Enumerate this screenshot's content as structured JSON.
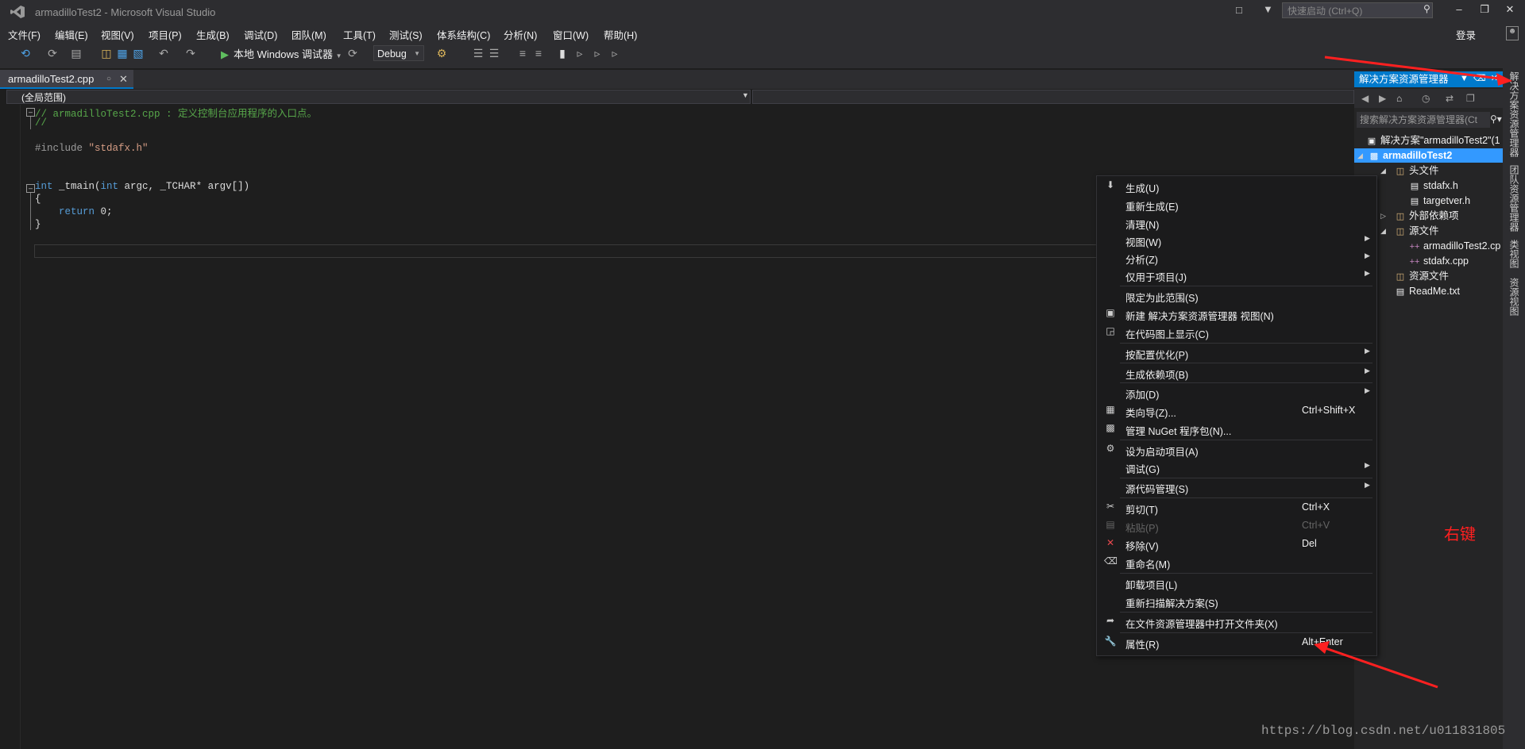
{
  "window": {
    "title": "armadilloTest2 - Microsoft Visual Studio",
    "quick_launch_placeholder": "快速启动 (Ctrl+Q)"
  },
  "menu": {
    "items": [
      "文件(F)",
      "编辑(E)",
      "视图(V)",
      "项目(P)",
      "生成(B)",
      "调试(D)",
      "团队(M)",
      "工具(T)",
      "测试(S)",
      "体系结构(C)",
      "分析(N)",
      "窗口(W)",
      "帮助(H)"
    ],
    "login": "登录"
  },
  "toolbar": {
    "run_label": "本地 Windows 调试器",
    "configuration": "Debug"
  },
  "editor": {
    "tab_title": "armadilloTest2.cpp",
    "scope": "(全局范围)",
    "code": {
      "line1": "// armadilloTest2.cpp : 定义控制台应用程序的入口点。",
      "line2": "//",
      "include_kw": "#include",
      "include_file": "\"stdafx.h\"",
      "main_kw": "int",
      "main_sig": " _tmain(",
      "main_kw2": "int",
      "main_rest": " argc, _TCHAR* argv[])",
      "brace_open": "{",
      "return_kw": "return",
      "return_rest": " 0;",
      "brace_close": "}"
    }
  },
  "solution_explorer": {
    "title": "解决方案资源管理器",
    "search_placeholder": "搜索解决方案资源管理器(Ct",
    "tree": {
      "solution": "解决方案\"armadilloTest2\"(1",
      "project": "armadilloTest2",
      "header_files": "头文件",
      "stdafx_h": "stdafx.h",
      "targetver_h": "targetver.h",
      "external_deps": "外部依赖项",
      "source_files": "源文件",
      "main_cpp": "armadilloTest2.cp",
      "stdafx_cpp": "stdafx.cpp",
      "resource_files": "资源文件",
      "readme": "ReadMe.txt"
    }
  },
  "side_tabs": [
    "解决方案资源管理器",
    "团队资源管理器",
    "类视图",
    "资源视图"
  ],
  "context_menu": {
    "items": [
      {
        "label": "生成(U)",
        "shortcut": "",
        "icon": "build-icon"
      },
      {
        "label": "重新生成(E)",
        "shortcut": ""
      },
      {
        "label": "清理(N)",
        "shortcut": ""
      },
      {
        "label": "视图(W)",
        "shortcut": "",
        "submenu": true
      },
      {
        "label": "分析(Z)",
        "shortcut": "",
        "submenu": true
      },
      {
        "label": "仅用于项目(J)",
        "shortcut": "",
        "submenu": true
      },
      {
        "label": "限定为此范围(S)",
        "shortcut": ""
      },
      {
        "label": "新建 解决方案资源管理器 视图(N)",
        "shortcut": "",
        "icon": "new-view-icon"
      },
      {
        "label": "在代码图上显示(C)",
        "shortcut": "",
        "icon": "code-map-icon"
      },
      {
        "label": "按配置优化(P)",
        "shortcut": "",
        "submenu": true
      },
      {
        "label": "生成依赖项(B)",
        "shortcut": "",
        "submenu": true
      },
      {
        "label": "添加(D)",
        "shortcut": "",
        "submenu": true
      },
      {
        "label": "类向导(Z)...",
        "shortcut": "Ctrl+Shift+X",
        "icon": "class-wizard-icon"
      },
      {
        "label": "管理 NuGet 程序包(N)...",
        "shortcut": "",
        "icon": "nuget-icon"
      },
      {
        "label": "设为启动项目(A)",
        "shortcut": "",
        "icon": "gear-icon"
      },
      {
        "label": "调试(G)",
        "shortcut": "",
        "submenu": true
      },
      {
        "label": "源代码管理(S)",
        "shortcut": "",
        "submenu": true
      },
      {
        "label": "剪切(T)",
        "shortcut": "Ctrl+X",
        "icon": "scissors-icon"
      },
      {
        "label": "粘贴(P)",
        "shortcut": "Ctrl+V",
        "icon": "paste-icon",
        "disabled": true
      },
      {
        "label": "移除(V)",
        "shortcut": "Del",
        "icon": "remove-icon"
      },
      {
        "label": "重命名(M)",
        "shortcut": "",
        "icon": "rename-icon"
      },
      {
        "label": "卸载项目(L)",
        "shortcut": ""
      },
      {
        "label": "重新扫描解决方案(S)",
        "shortcut": ""
      },
      {
        "label": "在文件资源管理器中打开文件夹(X)",
        "shortcut": "",
        "icon": "open-folder-icon"
      },
      {
        "label": "属性(R)",
        "shortcut": "Alt+Enter",
        "icon": "wrench-icon"
      }
    ]
  },
  "annotation": {
    "label": "右键",
    "color": "#ff2020"
  },
  "watermark": "https://blog.csdn.net/u011831805",
  "colors": {
    "accent": "#007acc",
    "selection": "#3399ff",
    "background": "#1e1e1e",
    "comment": "#57a64a",
    "keyword": "#569cd6",
    "string": "#d69d85"
  }
}
